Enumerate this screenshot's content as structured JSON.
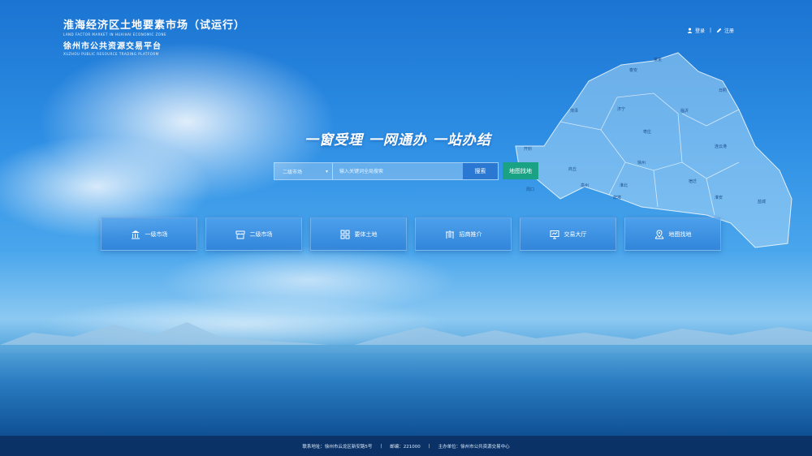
{
  "header": {
    "title": "淮海经济区土地要素市场（试运行）",
    "title_en": "LAND FACTOR MARKET IN HUAIHAI ECONOMIC ZONE",
    "subtitle": "徐州市公共资源交易平台",
    "subtitle_en": "XUZHOU PUBLIC RESOURCE TRADING PLATFORM"
  },
  "auth": {
    "login": "登录",
    "separator": "|",
    "register": "注册"
  },
  "slogan": "一窗受理 一网通办 一站办结",
  "search": {
    "market_select": "二级市场",
    "placeholder": "输入关键词全局搜索",
    "button": "搜索"
  },
  "map_button": "地图找地",
  "nav": [
    {
      "label": "一级市场",
      "icon": "bank-icon"
    },
    {
      "label": "二级市场",
      "icon": "store-icon"
    },
    {
      "label": "要体土地",
      "icon": "grid-icon"
    },
    {
      "label": "招商推介",
      "icon": "building-icon"
    },
    {
      "label": "交易大厅",
      "icon": "monitor-icon"
    },
    {
      "label": "地图找地",
      "icon": "map-pin-icon"
    }
  ],
  "map_cities": [
    "莱芜",
    "泰安",
    "日照",
    "菏泽",
    "济宁",
    "临沂",
    "枣庄",
    "连云港",
    "开封",
    "商丘",
    "徐州",
    "宿迁",
    "淮北",
    "周口",
    "亳州",
    "蚌埠",
    "淮安",
    "盐城"
  ],
  "footer": {
    "address": "联系地址：徐州市云龙区新安路5号",
    "postcode": "邮编：221000",
    "organizer": "主办单位：徐州市公共资源交易中心",
    "sep": "|"
  }
}
